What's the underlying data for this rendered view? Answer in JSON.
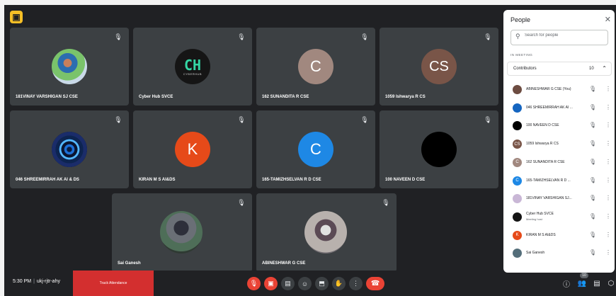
{
  "app": {
    "logo_letter": "▣"
  },
  "tiles": [
    {
      "name": "181VINAY VARSHIGAN SJ CSE",
      "avatar_type": "photo"
    },
    {
      "name": "Cyber Hub SVCE",
      "avatar_type": "logo",
      "logo_text": "CH",
      "logo_sub": "CYBERHUB"
    },
    {
      "name": "162 SUNANDITA R CSE",
      "avatar_type": "initial",
      "initial": "C",
      "color": "#a1887f"
    },
    {
      "name": "1059 Ishwarya R CS",
      "avatar_type": "initial",
      "initial": "CS",
      "color": "#795548"
    },
    {
      "name": "046 SHREEMIRRAH AK AI & DS",
      "avatar_type": "kaleidoscope"
    },
    {
      "name": "KIRAN M S AI&DS",
      "avatar_type": "initial",
      "initial": "K",
      "color": "#e64a19"
    },
    {
      "name": "165-TAMIZHSELVAN R D CSE",
      "avatar_type": "initial",
      "initial": "C",
      "color": "#1e88e5"
    },
    {
      "name": "100 NAVEEN D CSE",
      "avatar_type": "solid",
      "color": "#000000"
    },
    {
      "name": "Sai Ganesh",
      "avatar_type": "photo"
    },
    {
      "name": "ABINESHWAR G CSE",
      "avatar_type": "photo"
    }
  ],
  "bottom": {
    "time": "5:30 PM",
    "separator": "|",
    "meeting_code": "ukj-rjtr-ahy",
    "attendance_label": "Track Attendance",
    "people_count": "10",
    "icons": {
      "mic": "🎙",
      "camera": "▣",
      "captions": "▤",
      "emoji": "☺",
      "present": "⬒",
      "hand": "✋",
      "more": "⋮",
      "end_call": "☎",
      "info": "ⓘ",
      "people": "👥",
      "chat": "▤",
      "activities": "⬡"
    }
  },
  "panel": {
    "title": "People",
    "close": "✕",
    "search_placeholder": "Search for people",
    "section_label": "IN MEETING",
    "group_label": "Contributors",
    "group_count": "10",
    "group_chevron": "⌃",
    "participants": [
      {
        "name": "ABINESHWAR G CSE (You)",
        "color": "#6d4c41",
        "initial": "",
        "sub": ""
      },
      {
        "name": "046 SHREEMIRRAH AK AI ...",
        "color": "#1565c0",
        "initial": "",
        "sub": ""
      },
      {
        "name": "100 NAVEEN D CSE",
        "color": "#000000",
        "initial": "",
        "sub": ""
      },
      {
        "name": "1059 Ishwarya R CS",
        "color": "#795548",
        "initial": "CS",
        "sub": ""
      },
      {
        "name": "162 SUNANDITA R CSE",
        "color": "#a1887f",
        "initial": "C",
        "sub": ""
      },
      {
        "name": "165-TAMIZHSELVAN R D ...",
        "color": "#1e88e5",
        "initial": "C",
        "sub": ""
      },
      {
        "name": "181VINAY VARSHIGAN SJ...",
        "color": "#c9b7d6",
        "initial": "",
        "sub": ""
      },
      {
        "name": "Cyber Hub SVCE",
        "color": "#151515",
        "initial": "",
        "sub": "Meeting host"
      },
      {
        "name": "KIRAN M S AI&DS",
        "color": "#e64a19",
        "initial": "K",
        "sub": ""
      },
      {
        "name": "Sai Ganesh",
        "color": "#546e7a",
        "initial": "",
        "sub": ""
      }
    ],
    "mute_icon": "🎙",
    "more_icon": "⋮"
  }
}
